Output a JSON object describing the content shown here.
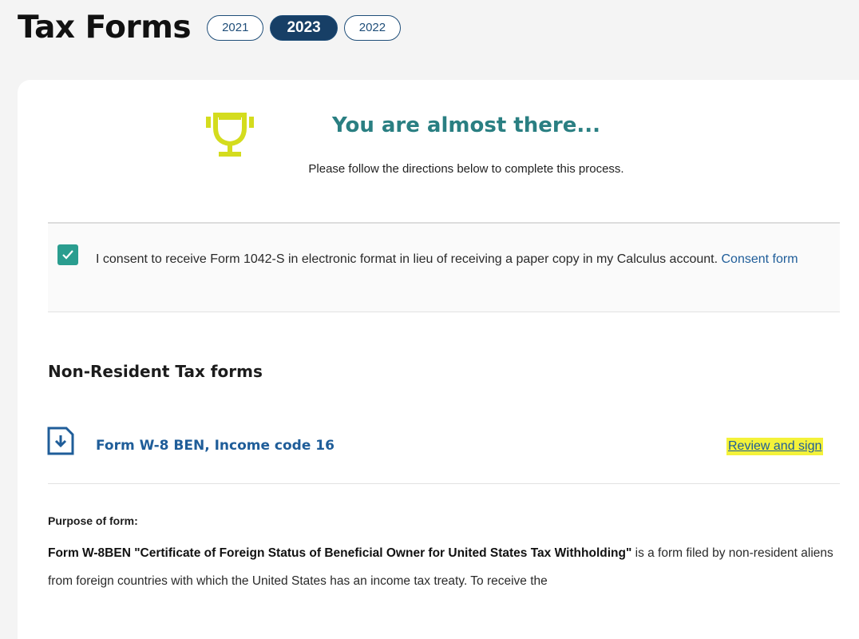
{
  "header": {
    "title": "Tax Forms",
    "years": [
      {
        "label": "2021",
        "active": false
      },
      {
        "label": "2023",
        "active": true
      },
      {
        "label": "2022",
        "active": false
      }
    ]
  },
  "hero": {
    "icon": "trophy-icon",
    "title": "You are almost there...",
    "subtitle": "Please follow the directions below to complete this process."
  },
  "consent": {
    "checked": true,
    "text": "I consent to receive Form 1042-S in electronic format in lieu of receiving a paper copy in my Calculus account.",
    "link_label": "Consent form"
  },
  "section": {
    "title": "Non-Resident Tax forms",
    "form": {
      "icon": "document-download-icon",
      "name": "Form W-8 BEN, Income code 16",
      "action_label": "Review and sign"
    },
    "purpose_label": "Purpose of form:",
    "purpose_bold": "Form W-8BEN \"Certificate of Foreign Status of Beneficial Owner for United States Tax Withholding\"",
    "purpose_text": " is a form filed by non-resident aliens from foreign countries with which the United States has an income tax treaty. To receive the"
  },
  "colors": {
    "accent_teal": "#2a7f82",
    "trophy": "#d4dc1e",
    "link_blue": "#1f5d99",
    "highlight": "#f4f23a",
    "pill_active": "#173f66"
  }
}
